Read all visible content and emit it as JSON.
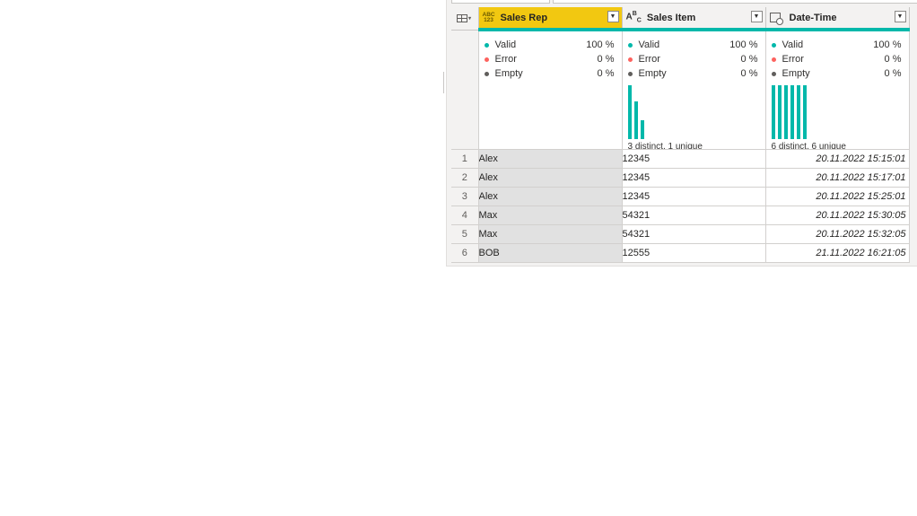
{
  "colors": {
    "valid": "#01b8aa",
    "error": "#fd625e",
    "empty": "#605e5c",
    "selected_header": "#f2c811"
  },
  "columns": [
    {
      "name": "Sales Rep",
      "type_icon": "abc-123-type-icon",
      "type_text": "ABC 123",
      "selected": true,
      "quality": {
        "valid_label": "Valid",
        "valid_pct": "100 %",
        "error_label": "Error",
        "error_pct": "0 %",
        "empty_label": "Empty",
        "empty_pct": "0 %"
      },
      "distribution": null
    },
    {
      "name": "Sales Item",
      "type_icon": "text-type-icon",
      "type_text": "ABC",
      "selected": false,
      "quality": {
        "valid_label": "Valid",
        "valid_pct": "100 %",
        "error_label": "Error",
        "error_pct": "0 %",
        "empty_label": "Empty",
        "empty_pct": "0 %"
      },
      "distribution": {
        "label": "3 distinct, 1 unique",
        "bars": [
          1.0,
          0.7,
          0.35
        ]
      }
    },
    {
      "name": "Date-Time",
      "type_icon": "datetime-type-icon",
      "type_text": "",
      "selected": false,
      "quality": {
        "valid_label": "Valid",
        "valid_pct": "100 %",
        "error_label": "Error",
        "error_pct": "0 %",
        "empty_label": "Empty",
        "empty_pct": "0 %"
      },
      "distribution": {
        "label": "6 distinct, 6 unique",
        "bars": [
          1.0,
          1.0,
          1.0,
          1.0,
          1.0,
          1.0
        ]
      }
    }
  ],
  "rows": [
    {
      "num": "1",
      "sales_rep": "Alex",
      "sales_item": "12345",
      "date_time": "20.11.2022 15:15:01"
    },
    {
      "num": "2",
      "sales_rep": "Alex",
      "sales_item": "12345",
      "date_time": "20.11.2022 15:17:01"
    },
    {
      "num": "3",
      "sales_rep": "Alex",
      "sales_item": "12345",
      "date_time": "20.11.2022 15:25:01"
    },
    {
      "num": "4",
      "sales_rep": "Max",
      "sales_item": "54321",
      "date_time": "20.11.2022 15:30:05"
    },
    {
      "num": "5",
      "sales_rep": "Max",
      "sales_item": "54321",
      "date_time": "20.11.2022 15:32:05"
    },
    {
      "num": "6",
      "sales_rep": "BOB",
      "sales_item": "12555",
      "date_time": "21.11.2022 16:21:05"
    }
  ]
}
